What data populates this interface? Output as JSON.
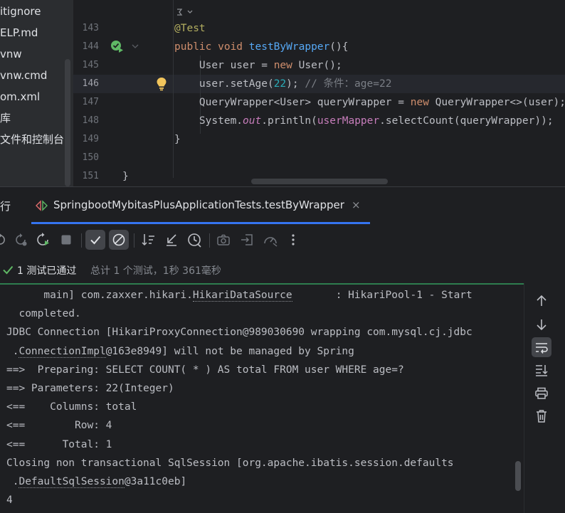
{
  "project_tree": {
    "items": [
      "itignore",
      "ELP.md",
      "vnw",
      "vnw.cmd",
      "om.xml",
      "库",
      "文件和控制台"
    ]
  },
  "editor": {
    "current_line": "146",
    "lines": [
      {
        "no": "143",
        "parts": [
          {
            "t": "@Test",
            "c": "ann"
          }
        ]
      },
      {
        "no": "144",
        "parts": [
          {
            "t": "public ",
            "c": "kw"
          },
          {
            "t": "void ",
            "c": "kw"
          },
          {
            "t": "testByWrapper",
            "c": "fn"
          },
          {
            "t": "(){",
            "c": "plain"
          }
        ]
      },
      {
        "no": "145",
        "parts": [
          {
            "t": "    User user = ",
            "c": "plain"
          },
          {
            "t": "new ",
            "c": "kw"
          },
          {
            "t": "User();",
            "c": "plain"
          }
        ]
      },
      {
        "no": "146",
        "parts": [
          {
            "t": "    user.setAge(",
            "c": "plain"
          },
          {
            "t": "22",
            "c": "num"
          },
          {
            "t": "); ",
            "c": "plain"
          },
          {
            "t": "// 条件：age=22",
            "c": "cmt"
          }
        ]
      },
      {
        "no": "147",
        "parts": [
          {
            "t": "    QueryWrapper<User> queryWrapper = ",
            "c": "plain"
          },
          {
            "t": "new ",
            "c": "kw"
          },
          {
            "t": "QueryWrapper<>(user);",
            "c": "plain"
          }
        ]
      },
      {
        "no": "148",
        "parts": [
          {
            "t": "    System.",
            "c": "plain"
          },
          {
            "t": "out",
            "c": "ital"
          },
          {
            "t": ".println(",
            "c": "plain"
          },
          {
            "t": "userMapper",
            "c": "fld"
          },
          {
            "t": ".selectCount(queryWrapper));",
            "c": "plain"
          }
        ]
      },
      {
        "no": "149",
        "parts": [
          {
            "t": "}",
            "c": "plain"
          }
        ]
      },
      {
        "no": "150",
        "parts": []
      },
      {
        "no": "151",
        "parts": [
          {
            "t": "}",
            "c": "plain"
          }
        ]
      }
    ]
  },
  "run_panel": {
    "title": "行",
    "tab_label": "SpringbootMybitasPlusApplicationTests.testByWrapper",
    "tab_close": "×",
    "status_passed": "1 测试已通过",
    "status_total": "总计 1 个测试，1秒 361毫秒",
    "console_lines": [
      {
        "parts": [
          {
            "t": "      main] com.zaxxer.hikari."
          },
          {
            "t": "HikariDataSource",
            "link": true
          },
          {
            "t": "       : HikariPool-1 - Start"
          }
        ]
      },
      {
        "parts": [
          {
            "t": "  completed."
          }
        ]
      },
      {
        "parts": [
          {
            "t": "JDBC Connection [HikariProxyConnection@989030690 wrapping com.mysql.cj.jdbc"
          }
        ]
      },
      {
        "parts": [
          {
            "t": " ."
          },
          {
            "t": "ConnectionImpl",
            "link": true
          },
          {
            "t": "@163e8949] will not be managed by Spring"
          }
        ]
      },
      {
        "parts": [
          {
            "t": "==>  Preparing: SELECT COUNT( * ) AS total FROM user WHERE age=?"
          }
        ]
      },
      {
        "parts": [
          {
            "t": "==> Parameters: 22(Integer)"
          }
        ]
      },
      {
        "parts": [
          {
            "t": "<==    Columns: total"
          }
        ]
      },
      {
        "parts": [
          {
            "t": "<==        Row: 4"
          }
        ]
      },
      {
        "parts": [
          {
            "t": "<==      Total: 1"
          }
        ]
      },
      {
        "parts": [
          {
            "t": "Closing non transactional SqlSession [org.apache.ibatis.session.defaults"
          }
        ]
      },
      {
        "parts": [
          {
            "t": " ."
          },
          {
            "t": "DefaultSqlSession",
            "link": true
          },
          {
            "t": "@3a11c0eb]"
          }
        ]
      },
      {
        "parts": [
          {
            "t": "4"
          }
        ]
      }
    ]
  },
  "colors": {
    "accent": "#3574f0",
    "passed": "#5fb865",
    "background": "#1e1f22"
  }
}
